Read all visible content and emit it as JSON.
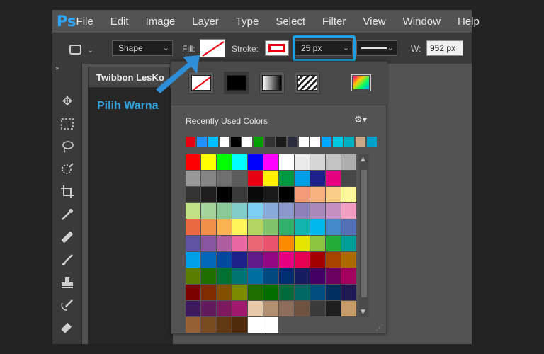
{
  "app": {
    "logo": "Ps"
  },
  "menu": [
    "File",
    "Edit",
    "Image",
    "Layer",
    "Type",
    "Select",
    "Filter",
    "View",
    "Window",
    "Help"
  ],
  "options": {
    "mode": "Shape",
    "fill_label": "Fill:",
    "stroke_label": "Stroke:",
    "stroke_width": "25 px",
    "width_label": "W:",
    "width_value": "952 px"
  },
  "document": {
    "tab_title": "Twibbon LesKo",
    "annotation": "Pilih Warna"
  },
  "swatch_panel": {
    "recent_label": "Recently Used Colors",
    "recent_colors": [
      "#e60012",
      "#1e90ff",
      "#00bfff",
      "#ffffff",
      "#000000",
      "#ffffff",
      "#00a000",
      "#333333",
      "#1a1a1a",
      "#2c2c3c",
      "#ffffff",
      "#ffffff",
      "#00a8ff",
      "#00c8e0",
      "#00b0c0",
      "#c8a888",
      "#00a0c8"
    ],
    "grid": [
      [
        "#ff0000",
        "#ffff00",
        "#00ff00",
        "#00ffff",
        "#0000ff",
        "#ff00ff",
        "#ffffff",
        "#ebebeb",
        "#d6d6d6",
        "#c2c2c2",
        "#adadad"
      ],
      [
        "#999999",
        "#858585",
        "#707070",
        "#5c5c5c",
        "#e60012",
        "#fff100",
        "#009944",
        "#00a0e9",
        "#1d2088",
        "#e4007f",
        "#474747"
      ],
      [
        "#333333",
        "#1e1e1e",
        "#000000",
        "#3a3a3a",
        "#0a0a0a",
        "#1a1a1a",
        "#000000",
        "#f29b76",
        "#f6b37f",
        "#facd89",
        "#fff799"
      ],
      [
        "#c2e287",
        "#a5d49b",
        "#89c997",
        "#84ccc9",
        "#7ecef4",
        "#88abda",
        "#8c97cb",
        "#8f82bc",
        "#aa89bd",
        "#c490bf",
        "#f19ec2"
      ],
      [
        "#ec6941",
        "#f19149",
        "#f8b551",
        "#fff45c",
        "#b3d465",
        "#80c269",
        "#32b16c",
        "#13b5b1",
        "#00b7ee",
        "#448aca",
        "#556fb5"
      ],
      [
        "#5f52a0",
        "#8957a1",
        "#ae5da1",
        "#ea68a2",
        "#eb6877",
        "#e9556c",
        "#ff8c00",
        "#e5e500",
        "#8cc63f",
        "#22ac38",
        "#009e96"
      ],
      [
        "#00a0e9",
        "#0068b7",
        "#00479d",
        "#1d2088",
        "#601986",
        "#920783",
        "#e4007f",
        "#e5004f",
        "#a40000",
        "#a84200",
        "#ac6a00"
      ],
      [
        "#5b7e00",
        "#1e6e00",
        "#007130",
        "#007470",
        "#006e9f",
        "#004a80",
        "#002e73",
        "#171c61",
        "#440062",
        "#6a005f",
        "#a1005e"
      ],
      [
        "#7d0000",
        "#7f2d00",
        "#825100",
        "#7c8c00",
        "#1e6e00",
        "#006d00",
        "#006c3b",
        "#006763",
        "#004d7e",
        "#003060",
        "#211b53"
      ],
      [
        "#3c1a5b",
        "#5f1b5c",
        "#7c1a5e",
        "#a1196c",
        "#e6c9a8",
        "#b28f70",
        "#8c6d5c",
        "#6e5341",
        "#3a3a3a",
        "#1e1e1e",
        "#c69c6d"
      ],
      [
        "#956134",
        "#7a4a20",
        "#603913",
        "#4f2b0c",
        "#ffffff",
        "#ffffff",
        "#535353",
        "#535353",
        "#535353",
        "#535353",
        "#535353"
      ]
    ]
  },
  "colors": {
    "accent_blue": "#1da1e2",
    "stroke_red": "#e60012"
  }
}
